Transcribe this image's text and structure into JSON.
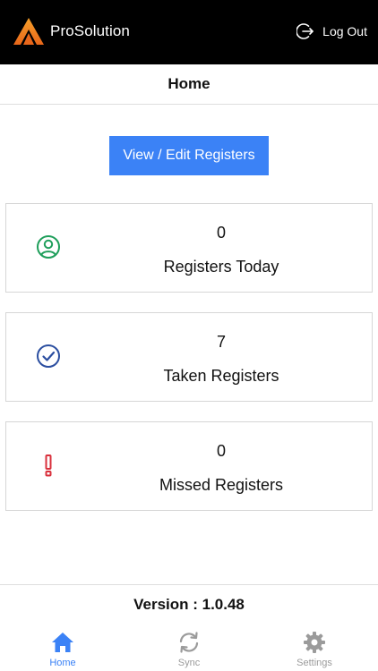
{
  "app": {
    "name": "ProSolution",
    "logout_label": "Log Out"
  },
  "header": {
    "title": "Home"
  },
  "main": {
    "view_edit_button": "View / Edit Registers",
    "cards": [
      {
        "value": "0",
        "label": "Registers Today",
        "icon": "user-circle-icon",
        "icon_color": "#1e9e5a"
      },
      {
        "value": "7",
        "label": "Taken Registers",
        "icon": "check-circle-icon",
        "icon_color": "#2b4ea0"
      },
      {
        "value": "0",
        "label": "Missed Registers",
        "icon": "exclamation-icon",
        "icon_color": "#d9303c"
      }
    ]
  },
  "footer": {
    "version": "Version : 1.0.48"
  },
  "tabbar": {
    "items": [
      {
        "label": "Home",
        "icon": "home-icon",
        "active": true
      },
      {
        "label": "Sync",
        "icon": "sync-icon",
        "active": false
      },
      {
        "label": "Settings",
        "icon": "gear-icon",
        "active": false
      }
    ]
  },
  "colors": {
    "accent": "#3b82f6",
    "topbar": "#000000",
    "logo_orange": "#f08a1c",
    "inactive": "#9b9b9b"
  }
}
